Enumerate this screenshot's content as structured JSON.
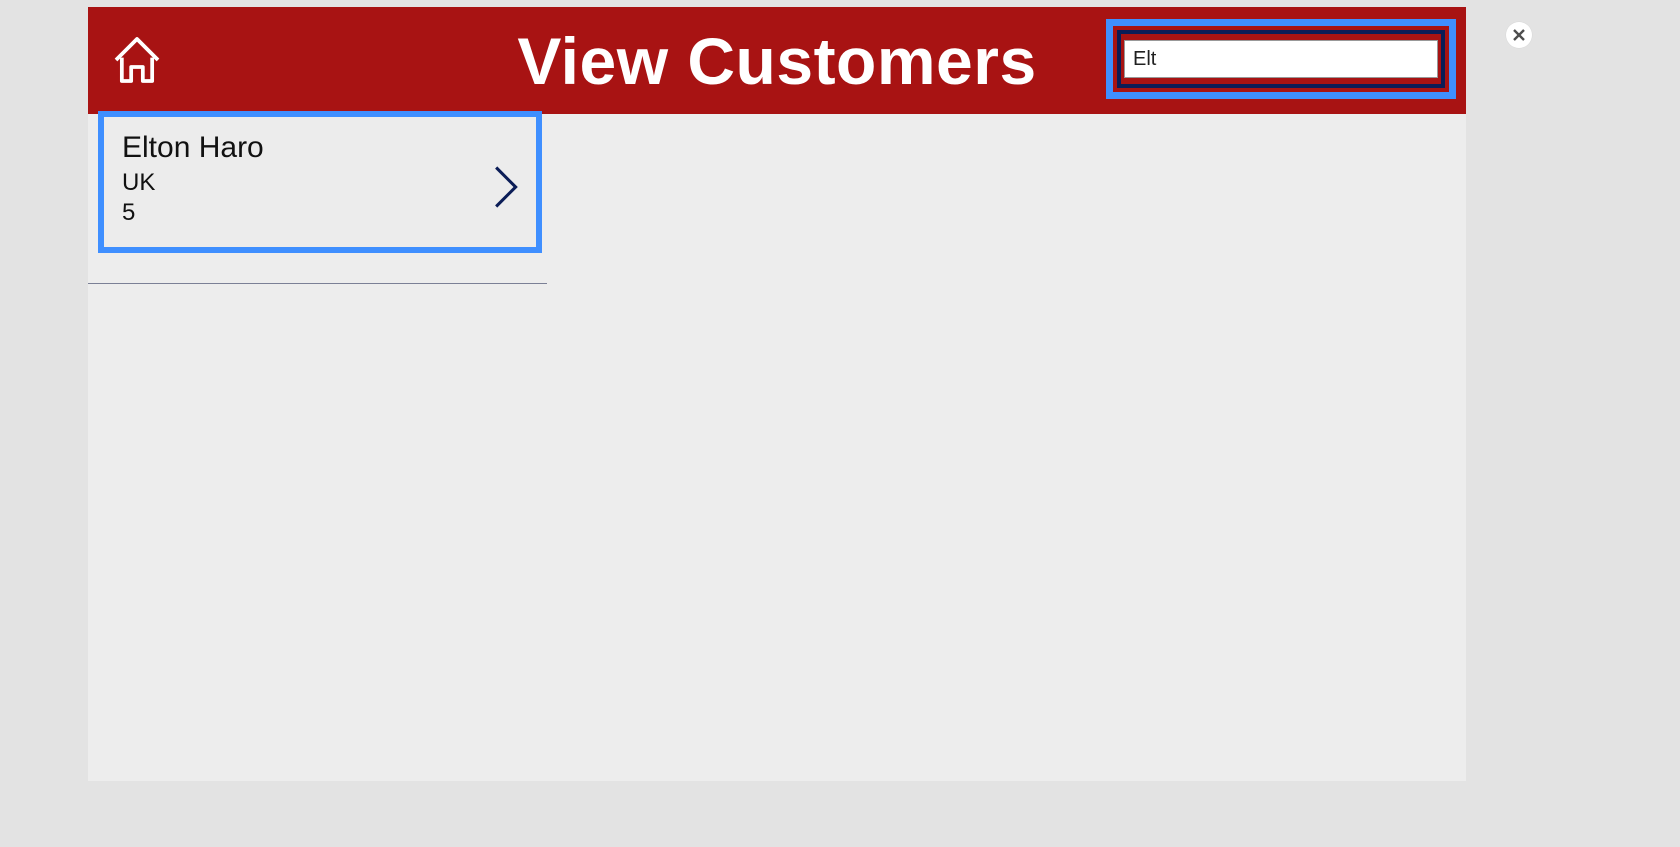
{
  "header": {
    "title": "View Customers"
  },
  "search": {
    "value": "Elt"
  },
  "customers": [
    {
      "name": "Elton  Haro",
      "country": "UK",
      "id": "5"
    }
  ]
}
